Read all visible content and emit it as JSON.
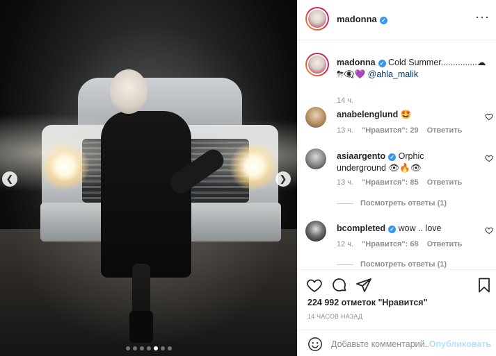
{
  "post": {
    "username": "madonna",
    "caption_user": "madonna",
    "caption_text": "Cold Summer...............☁ ⛈👁‍🗨💜",
    "caption_mention": "@ahla_malik",
    "caption_time": "14 ч."
  },
  "comments": [
    {
      "user": "anabelenglund",
      "text": "🤩",
      "time": "13 ч.",
      "likes": "\"Нравится\": 29",
      "reply": "Ответить"
    },
    {
      "user": "asiaargento",
      "text": "Orphic underground 👁🔥👁",
      "time": "13 ч.",
      "likes": "\"Нравится\": 85",
      "reply": "Ответить",
      "view_replies": "Посмотреть ответы (1)"
    },
    {
      "user": "bcompleted",
      "text": "wow .. love",
      "time": "12 ч.",
      "likes": "\"Нравится\": 68",
      "reply": "Ответить",
      "view_replies": "Посмотреть ответы (1)"
    }
  ],
  "actions": {
    "likes": "224 992 отметок \"Нравится\"",
    "time_ago": "14 ЧАСОВ НАЗАД",
    "comment_placeholder": "Добавьте комментарий...",
    "post_label": "Опубликовать"
  },
  "carousel": {
    "total": 7,
    "active": 5
  },
  "icons": {
    "verified": "verified-badge-icon",
    "more": "more-options-icon",
    "heart": "heart-icon",
    "comment": "comment-icon",
    "share": "share-icon",
    "save": "bookmark-icon",
    "emoji": "emoji-icon",
    "prev": "chevron-left-icon",
    "next": "chevron-right-icon"
  },
  "colors": {
    "verified": "#3897f0",
    "link": "#00376b",
    "post_button": "#b2dffc",
    "muted": "#8e8e8e"
  }
}
